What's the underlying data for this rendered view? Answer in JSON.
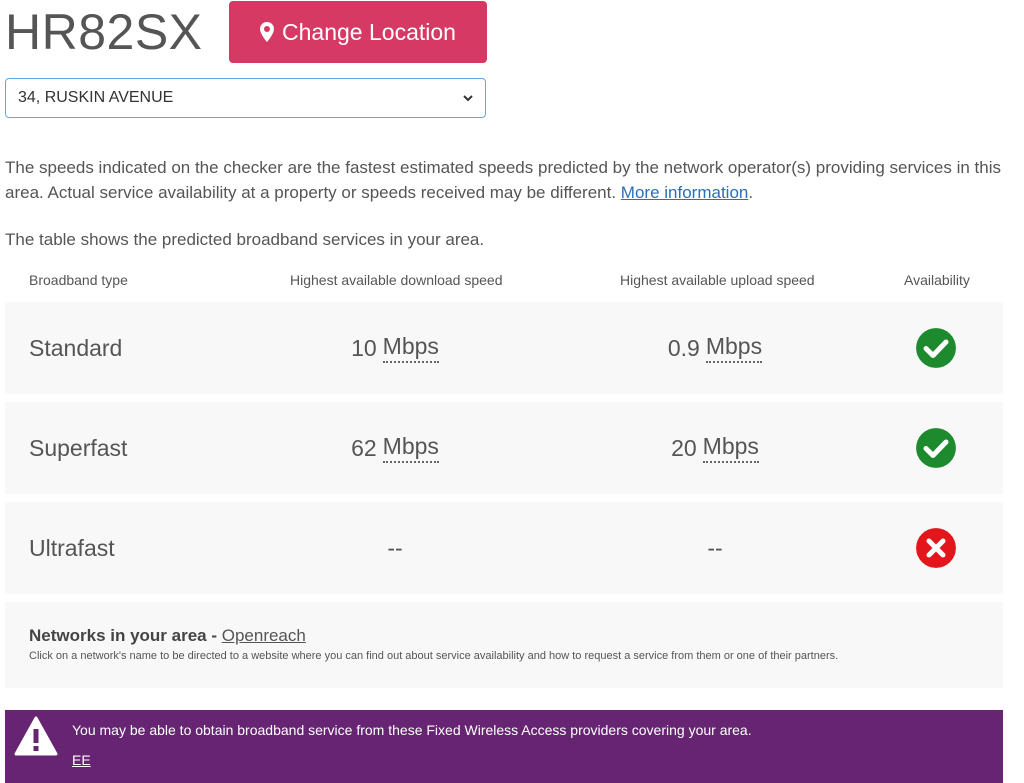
{
  "header": {
    "postcode": "HR82SX",
    "change_location_label": "Change Location"
  },
  "address_select": {
    "selected": "34, RUSKIN AVENUE"
  },
  "info": {
    "text": "The speeds indicated on the checker are the fastest estimated speeds predicted by the network operator(s) providing services in this area. Actual service availability at a property or speeds received may be different. ",
    "more_link": "More information",
    "after_link": "."
  },
  "table": {
    "intro": "The table shows the predicted broadband services in your area.",
    "headers": {
      "type": "Broadband type",
      "download": "Highest available download speed",
      "upload": "Highest available upload speed",
      "availability": "Availability"
    },
    "rows": [
      {
        "type": "Standard",
        "download": "10",
        "download_unit": "Mbps",
        "upload": "0.9",
        "upload_unit": "Mbps",
        "available": true
      },
      {
        "type": "Superfast",
        "download": "62",
        "download_unit": "Mbps",
        "upload": "20",
        "upload_unit": "Mbps",
        "available": true
      },
      {
        "type": "Ultrafast",
        "download": "--",
        "download_unit": "",
        "upload": "--",
        "upload_unit": "",
        "available": false
      }
    ]
  },
  "networks": {
    "title": "Networks in your area - ",
    "link": "Openreach",
    "note": "Click on a network's name to be directed to a website where you can find out about service availability and how to request a service from them or one of their partners."
  },
  "banner": {
    "message": "You may be able to obtain broadband service from these Fixed Wireless Access providers covering your area.",
    "link": "EE"
  },
  "colors": {
    "accent": "#d63a64",
    "available": "#1e8a2e",
    "unavailable": "#e3161b",
    "banner": "#662473"
  }
}
